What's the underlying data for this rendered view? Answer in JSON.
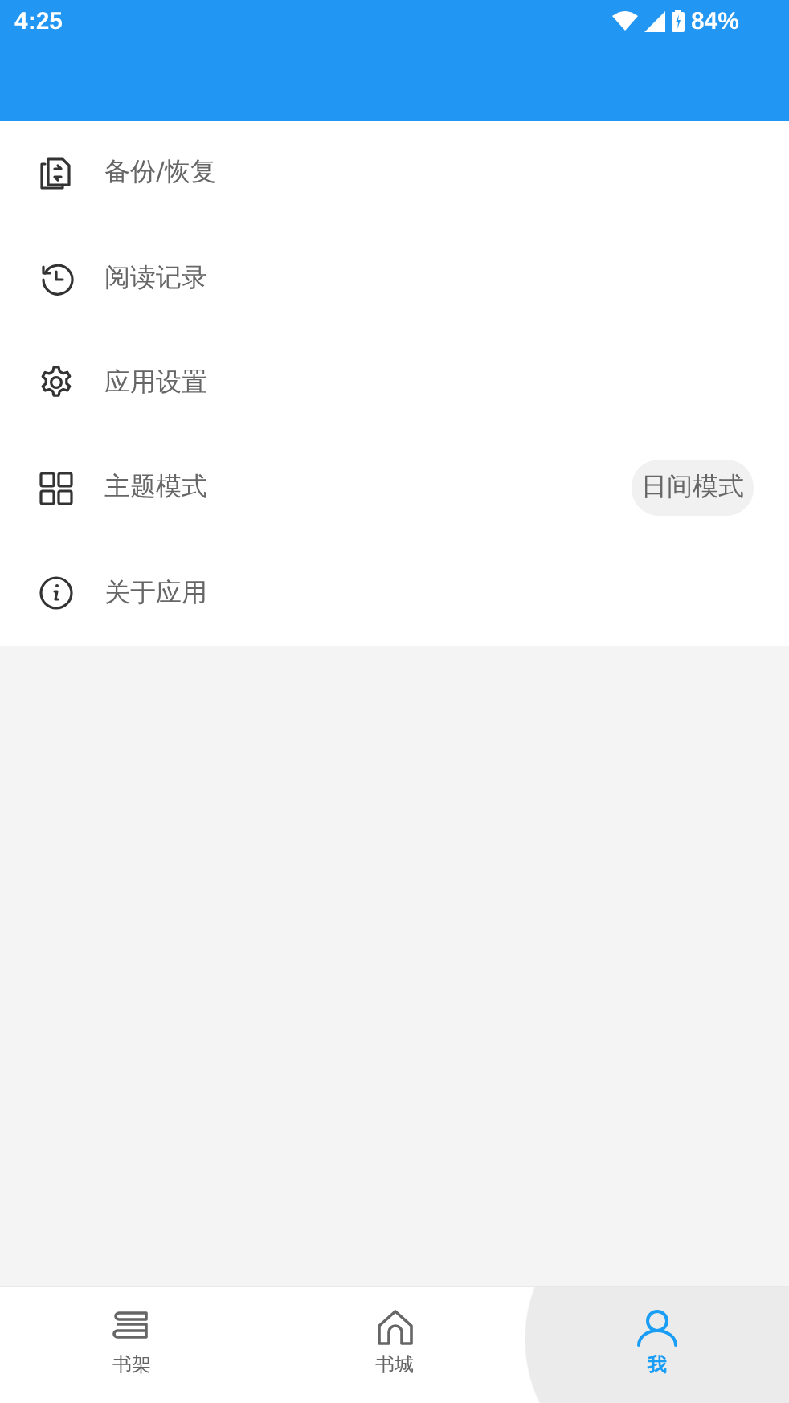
{
  "status_bar": {
    "time": "4:25",
    "battery": "84%"
  },
  "menu": [
    {
      "label": "备份/恢复",
      "kind": "plain"
    },
    {
      "label": "阅读记录",
      "kind": "plain"
    },
    {
      "label": "应用设置",
      "kind": "plain"
    },
    {
      "label": "主题模式",
      "kind": "value",
      "value": "日间模式"
    },
    {
      "label": "关于应用",
      "kind": "plain"
    }
  ],
  "bottom_nav": [
    {
      "label": "书架",
      "selected": false
    },
    {
      "label": "书城",
      "selected": false
    },
    {
      "label": "我",
      "selected": true
    }
  ]
}
